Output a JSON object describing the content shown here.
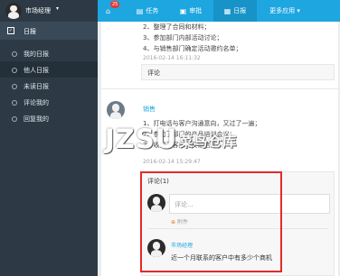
{
  "header": {
    "user_name": "市场经理",
    "user_caret": "▾",
    "badge_count": "25",
    "nav": [
      {
        "label": "任务",
        "icon": "▤"
      },
      {
        "label": "审批",
        "icon": "▣"
      },
      {
        "label": "日报",
        "icon": "▦"
      },
      {
        "label": "更多应用 ▾",
        "icon": ""
      }
    ]
  },
  "sidebar": {
    "section_title": "日报",
    "items": [
      {
        "label": "我的日报"
      },
      {
        "label": "他人日报"
      },
      {
        "label": "未读日报"
      },
      {
        "label": "评论我的"
      },
      {
        "label": "回复我的"
      }
    ]
  },
  "report1": {
    "lines": [
      "2、整理了合同和材料；",
      "3、参加部门内部活动讨论；",
      "4、与销售部门确定活动邀约名单；"
    ],
    "time": "2016-02-14 16:11:32",
    "comment_label": "评论"
  },
  "report2": {
    "author": "销售",
    "lines": [
      "1、打电话与客户沟通意向，又过了一遍；",
      "2、参加了部门的产品培训会议；",
      "3、收到了客户的反馈信息；"
    ],
    "time": "2016-02-14 15:29:47"
  },
  "comments": {
    "title": "评论(1)",
    "input_placeholder": "评论...",
    "attach_label": "附件",
    "attach_icon": "⊕",
    "items": [
      {
        "author": "市场经理",
        "text": "近一个月联系的客户中有多少个商机"
      }
    ]
  },
  "watermark": {
    "text": "JZSU",
    "cn": "菜鸟仓库"
  }
}
